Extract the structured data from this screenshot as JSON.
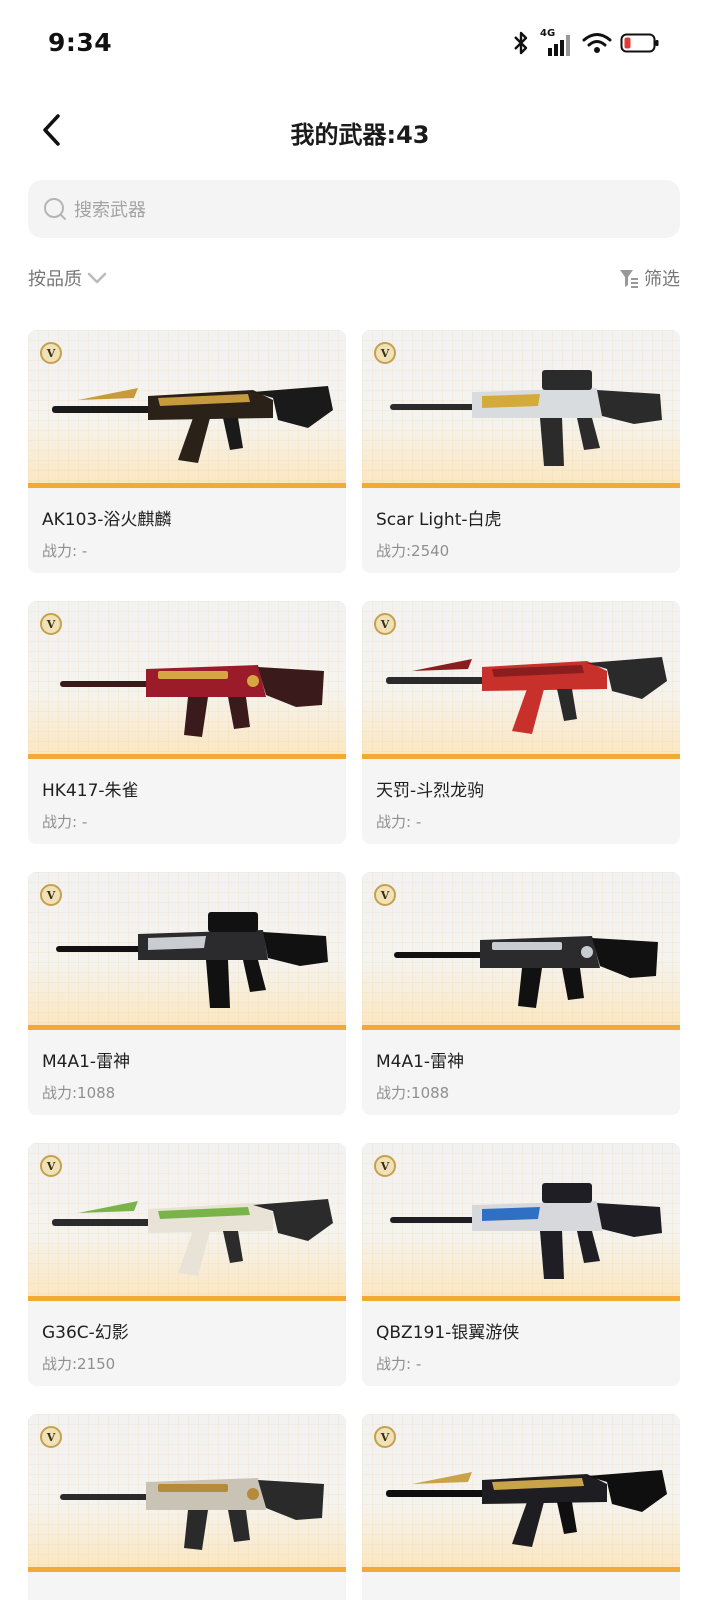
{
  "status_bar": {
    "time": "9:34",
    "network_label": "4G"
  },
  "header": {
    "title": "我的武器:43",
    "back_icon": "chevron-left-icon"
  },
  "search": {
    "placeholder": "搜索武器",
    "icon": "search-icon"
  },
  "sort": {
    "label": "按品质",
    "icon": "chevron-down-icon"
  },
  "filter": {
    "label": "筛选",
    "icon": "filter-icon"
  },
  "colors": {
    "accent_orange": "#f2a935",
    "badge_gold": "#c6a04d",
    "battery_red": "#e53935"
  },
  "weapons": [
    {
      "badge": "V",
      "name": "AK103-浴火麒麟",
      "power": "战力: -",
      "palette": {
        "body": "#2a2118",
        "accent": "#c79a3e",
        "trim": "#1a1a1a"
      }
    },
    {
      "badge": "V",
      "name": "Scar Light-白虎",
      "power": "战力:2540",
      "palette": {
        "body": "#d9dcdf",
        "accent": "#d4aa3a",
        "trim": "#2b2b2b"
      }
    },
    {
      "badge": "V",
      "name": "HK417-朱雀",
      "power": "战力: -",
      "palette": {
        "body": "#9b1b2a",
        "accent": "#d6a640",
        "trim": "#3a1a1a"
      }
    },
    {
      "badge": "V",
      "name": "天罚-斗烈龙驹",
      "power": "战力: -",
      "palette": {
        "body": "#c8302c",
        "accent": "#8a1e1e",
        "trim": "#2a2a2a"
      }
    },
    {
      "badge": "V",
      "name": "M4A1-雷神",
      "power": "战力:1088",
      "palette": {
        "body": "#2b2b2e",
        "accent": "#c9ccd1",
        "trim": "#111111"
      }
    },
    {
      "badge": "V",
      "name": "M4A1-雷神",
      "power": "战力:1088",
      "palette": {
        "body": "#2b2b2e",
        "accent": "#c9ccd1",
        "trim": "#111111"
      }
    },
    {
      "badge": "V",
      "name": "G36C-幻影",
      "power": "战力:2150",
      "palette": {
        "body": "#e8e3d6",
        "accent": "#7ab34a",
        "trim": "#2b2b2b"
      }
    },
    {
      "badge": "V",
      "name": "QBZ191-银翼游侠",
      "power": "战力: -",
      "palette": {
        "body": "#d6d8dc",
        "accent": "#2f6fc4",
        "trim": "#1e1e24"
      }
    },
    {
      "badge": "V",
      "name": "",
      "power": "",
      "palette": {
        "body": "#c9c3b5",
        "accent": "#b58a3a",
        "trim": "#2a2a2a"
      }
    },
    {
      "badge": "V",
      "name": "",
      "power": "",
      "palette": {
        "body": "#1e1e22",
        "accent": "#c9a34a",
        "trim": "#0f0f0f"
      }
    }
  ]
}
